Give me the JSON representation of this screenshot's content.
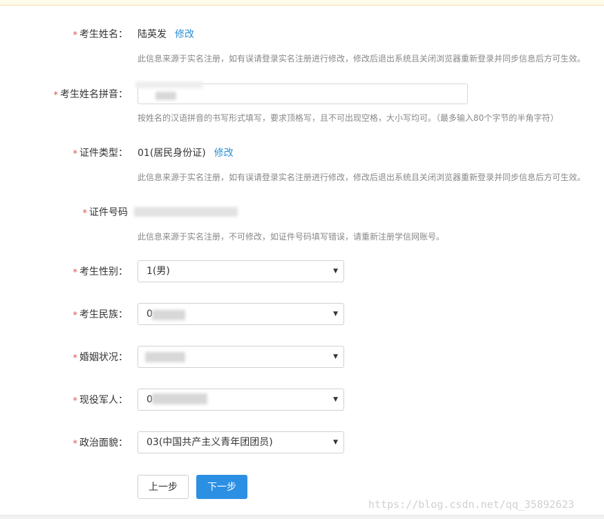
{
  "form": {
    "name": {
      "label": "考生姓名：",
      "value": "陆英发",
      "edit_link": "修改",
      "hint": "此信息来源于实名注册，如有误请登录实名注册进行修改，修改后退出系统且关闭浏览器重新登录并同步信息后方可生效。"
    },
    "pinyin": {
      "label": "考生姓名拼音：",
      "hint": "按姓名的汉语拼音的书写形式填写，要求顶格写，且不可出现空格，大小写均可。（最多输入80个字节的半角字符）"
    },
    "id_type": {
      "label": "证件类型：",
      "value": "01(居民身份证)",
      "edit_link": "修改",
      "hint": "此信息来源于实名注册，如有误请登录实名注册进行修改，修改后退出系统且关闭浏览器重新登录并同步信息后方可生效。"
    },
    "id_number": {
      "label": "证件号码",
      "hint": "此信息来源于实名注册，不可修改，如证件号码填写错误，请重新注册学信网账号。"
    },
    "gender": {
      "label": "考生性别：",
      "value": "1(男)"
    },
    "ethnicity": {
      "label": "考生民族：",
      "value": "0"
    },
    "marital": {
      "label": "婚姻状况：",
      "value": ""
    },
    "military": {
      "label": "现役军人：",
      "value": "0"
    },
    "political": {
      "label": "政治面貌：",
      "value": "03(中国共产主义青年团团员)"
    },
    "required_mark": "*"
  },
  "buttons": {
    "prev": "上一步",
    "next": "下一步"
  },
  "watermark": "https://blog.csdn.net/qq_35892623",
  "colors": {
    "accent": "#2b8fe4",
    "required": "#d9534f",
    "link": "#2a8fd6"
  },
  "icons": {
    "select_arrow": "▼"
  }
}
